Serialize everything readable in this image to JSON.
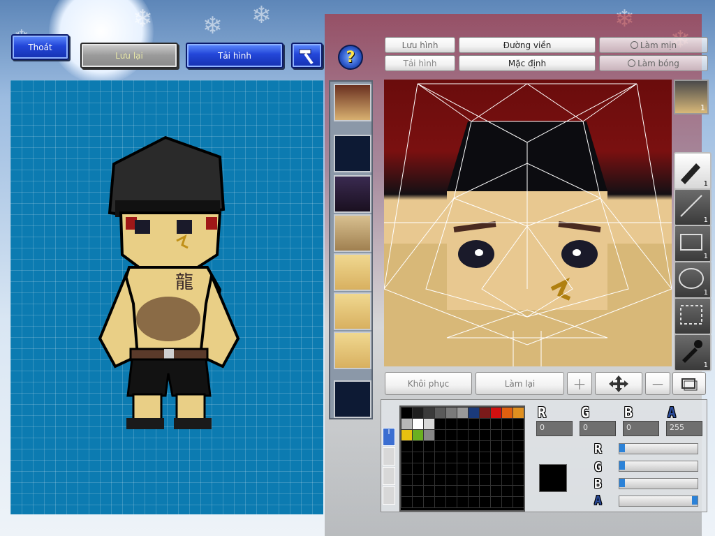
{
  "toolbar": {
    "exit_label": "Thoát",
    "save_label": "Lưu lại",
    "reload_label": "Tải hình"
  },
  "editor_tabs": {
    "save_image": "Lưu hình",
    "outline": "Đường viền",
    "smooth": "Làm mịn",
    "reload_image": "Tải hình",
    "default": "Mặc định",
    "shade": "Làm bóng"
  },
  "edit_actions": {
    "restore": "Khôi phục",
    "redo": "Làm lại"
  },
  "tool_counts": {
    "pen": "1",
    "line": "1",
    "rect": "1",
    "ellipse": "1",
    "select": "",
    "eyedropper": "1",
    "face_thumb": "1"
  },
  "color": {
    "r_value": "0",
    "g_value": "0",
    "b_value": "0",
    "a_value": "255",
    "current_hex": "#000000",
    "r_fraction": 0.0,
    "g_fraction": 0.0,
    "b_fraction": 0.0,
    "a_fraction": 1.0,
    "palette_row1": [
      "#000000",
      "#1e1e1e",
      "#3a3a3a",
      "#5a5a5a",
      "#7a7a7a",
      "#9a9a9a",
      "#1a3a7a",
      "#7a1a1a",
      "#d01010",
      "#e06010",
      "#e09020"
    ],
    "palette_row2": [
      "#b8b8b8",
      "#ffffff",
      "#d8d8d8",
      "#000000",
      "#000000",
      "#000000",
      "#000000",
      "#000000",
      "#000000",
      "#000000",
      "#000000"
    ],
    "palette_row3": [
      "#e8c010",
      "#6ab020",
      "#888888",
      "#000000",
      "#000000",
      "#000000",
      "#000000",
      "#000000",
      "#000000",
      "#000000",
      "#000000"
    ]
  },
  "channel_labels": {
    "r": "R",
    "g": "G",
    "b": "B",
    "a": "A"
  },
  "help_icon": "?"
}
